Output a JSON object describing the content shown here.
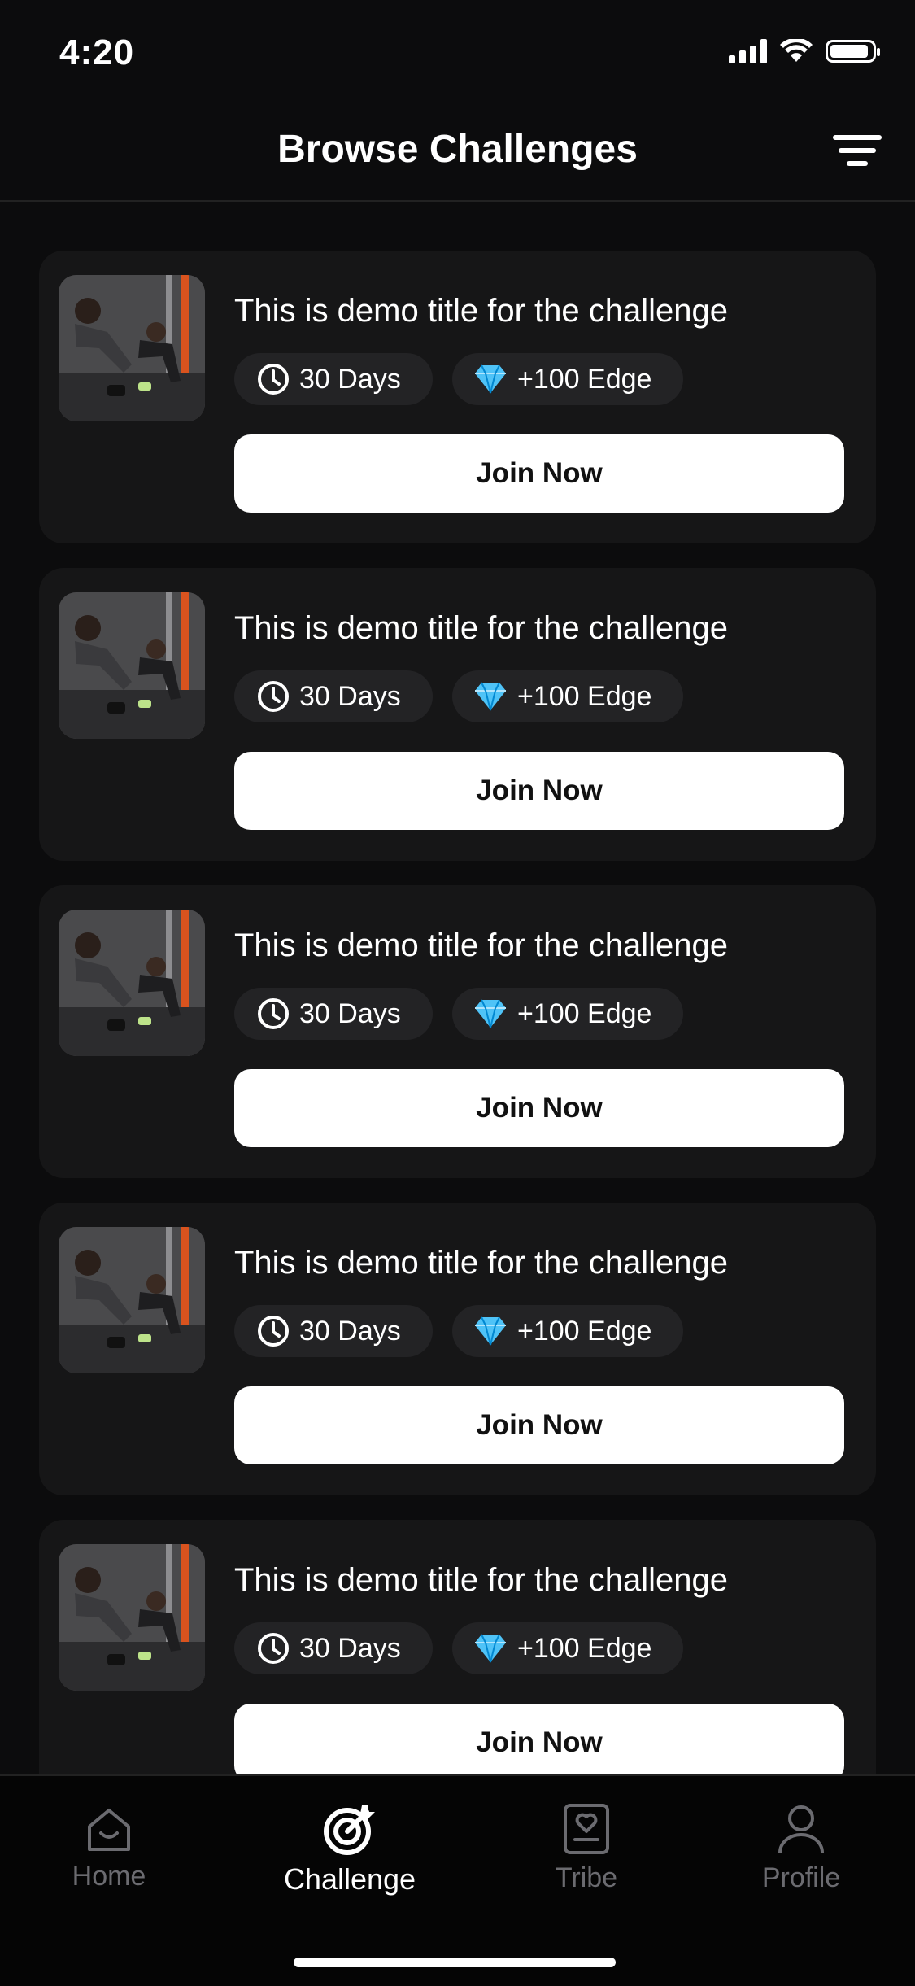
{
  "status": {
    "time": "4:20"
  },
  "header": {
    "title": "Browse Challenges"
  },
  "challenges": [
    {
      "title": "This is demo title for the challenge",
      "duration": "30 Days",
      "reward": "+100 Edge",
      "button": "Join Now"
    },
    {
      "title": "This is demo title for the challenge",
      "duration": "30 Days",
      "reward": "+100 Edge",
      "button": "Join Now"
    },
    {
      "title": "This is demo title for the challenge",
      "duration": "30 Days",
      "reward": "+100 Edge",
      "button": "Join Now"
    },
    {
      "title": "This is demo title for the challenge",
      "duration": "30 Days",
      "reward": "+100 Edge",
      "button": "Join Now"
    },
    {
      "title": "This is demo title for the challenge",
      "duration": "30 Days",
      "reward": "+100 Edge",
      "button": "Join Now"
    }
  ],
  "tabs": [
    {
      "label": "Home",
      "icon": "home-icon",
      "active": false
    },
    {
      "label": "Challenge",
      "icon": "target-icon",
      "active": true
    },
    {
      "label": "Tribe",
      "icon": "tribe-icon",
      "active": false
    },
    {
      "label": "Profile",
      "icon": "profile-icon",
      "active": false
    }
  ],
  "colors": {
    "background": "#0c0c0d",
    "card": "#161617",
    "chip": "#232325",
    "inactive_tab": "#6b6b70",
    "diamond": "#4fc3f7"
  }
}
